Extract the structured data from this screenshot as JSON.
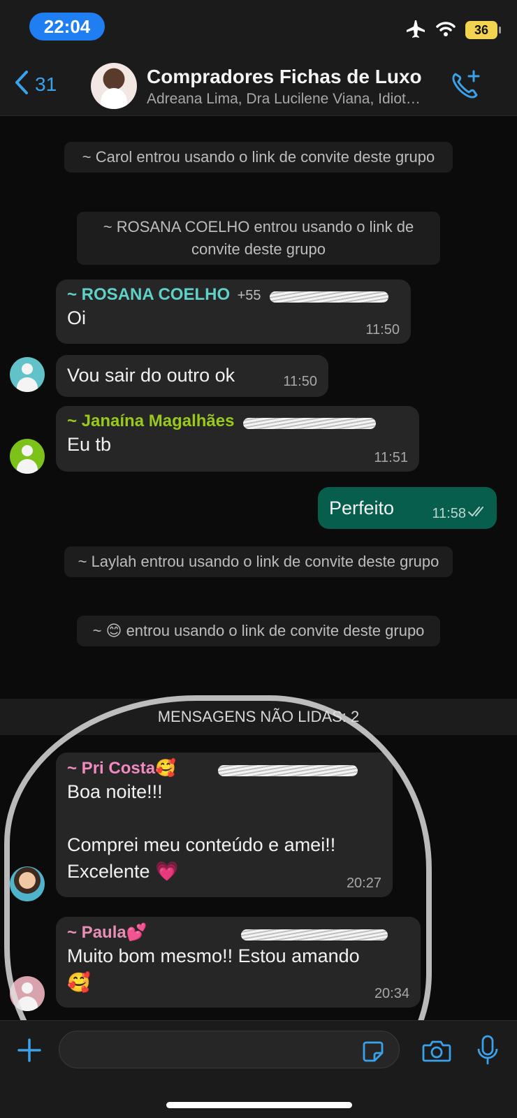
{
  "status_bar": {
    "time": "22:04",
    "battery": "36"
  },
  "header": {
    "back_count": "31",
    "title": "Compradores Fichas de Luxo",
    "subtitle": "Adreana Lima, Dra Lucilene Viana, Idiot…"
  },
  "messages": {
    "sys_carol": "~ Carol entrou usando o link de convite deste grupo",
    "sys_rosana": "~ ROSANA COELHO entrou usando o link de convite deste grupo",
    "rosana": {
      "sender": "~ ROSANA COELHO",
      "phone_prefix": "+55",
      "text": "Oi",
      "time": "11:50"
    },
    "rosana2": {
      "text": "Vou sair do outro ok",
      "time": "11:50"
    },
    "janaina": {
      "sender": "~ Janaína Magalhães",
      "text": "Eu tb",
      "time": "11:51"
    },
    "outgoing": {
      "text": "Perfeito",
      "time": "11:58"
    },
    "sys_laylah": "~ Laylah entrou usando o link de convite deste grupo",
    "sys_emoji": "~ 😊  entrou usando o link de convite deste grupo",
    "unread": "MENSAGENS NÃO LIDAS: 2",
    "pri": {
      "sender": "~ Pri Costa🥰",
      "text": "Boa noite!!!\n\nComprei meu conteúdo e amei!!\nExcelente 💗",
      "time": "20:27"
    },
    "paula": {
      "sender": "~ Paula💕",
      "text": "Muito bom mesmo!! Estou amando\n🥰",
      "time": "20:34"
    }
  },
  "colors": {
    "accent": "#3aa2ea",
    "rosana_name": "#5fd1c8",
    "janaina_name": "#98c91b",
    "pri_name": "#f08ac0",
    "paula_name": "#e58fb7",
    "outgoing_bubble": "#075e4d"
  },
  "input": {
    "placeholder": ""
  }
}
